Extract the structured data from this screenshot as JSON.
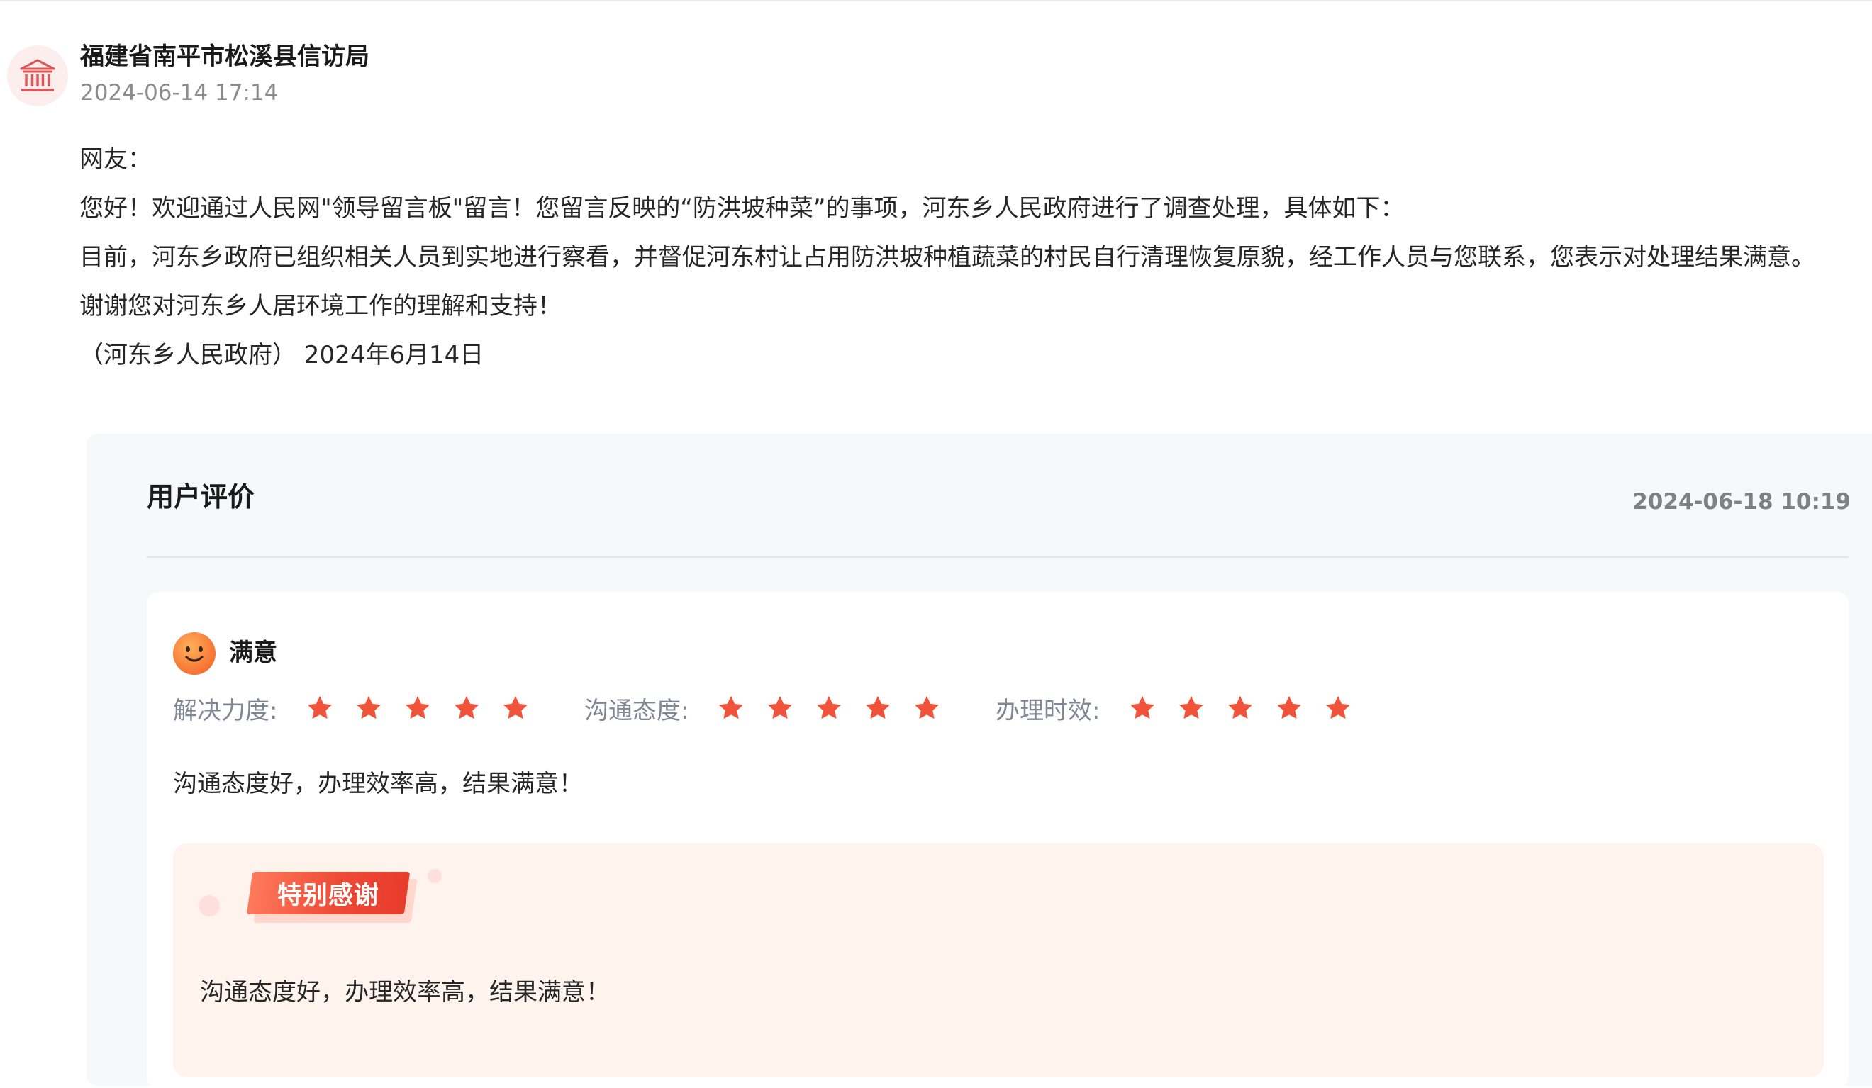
{
  "reply": {
    "org_name": "福建省南平市松溪县信访局",
    "time": "2024-06-14 17:14",
    "avatar_icon": "government-building-icon",
    "body_lines": [
      "网友：",
      " 您好！欢迎通过人民网\"领导留言板\"留言！您留言反映的“防洪坡种菜”的事项，河东乡人民政府进行了调查处理，具体如下：",
      "目前，河东乡政府已组织相关人员到实地进行察看，并督促河东村让占用防洪坡种植蔬菜的村民自行清理恢复原貌，经工作人员与您联系，您表示对处理结果满意。",
      "谢谢您对河东乡人居环境工作的理解和支持！",
      "（河东乡人民政府） 2024年6月14日"
    ]
  },
  "review": {
    "title": "用户评价",
    "date": "2024-06-18 10:19",
    "level_icon": "smiley-face-icon",
    "level": "满意",
    "ratings": [
      {
        "label": "解决力度:",
        "stars": 5,
        "max": 5
      },
      {
        "label": "沟通态度:",
        "stars": 5,
        "max": 5
      },
      {
        "label": "办理时效:",
        "stars": 5,
        "max": 5
      }
    ],
    "comment": "沟通态度好，办理效率高，结果满意！",
    "thanks": {
      "badge": "特别感谢",
      "text": "沟通态度好，办理效率高，结果满意！"
    }
  },
  "colors": {
    "star": "#f0533a",
    "badge": "#ee4b36",
    "thanks_bg": "#fff3ee",
    "card_bg": "#f7f8fa",
    "avatar_bg": "#fdeeee",
    "muted_text": "#8c8c8c"
  }
}
